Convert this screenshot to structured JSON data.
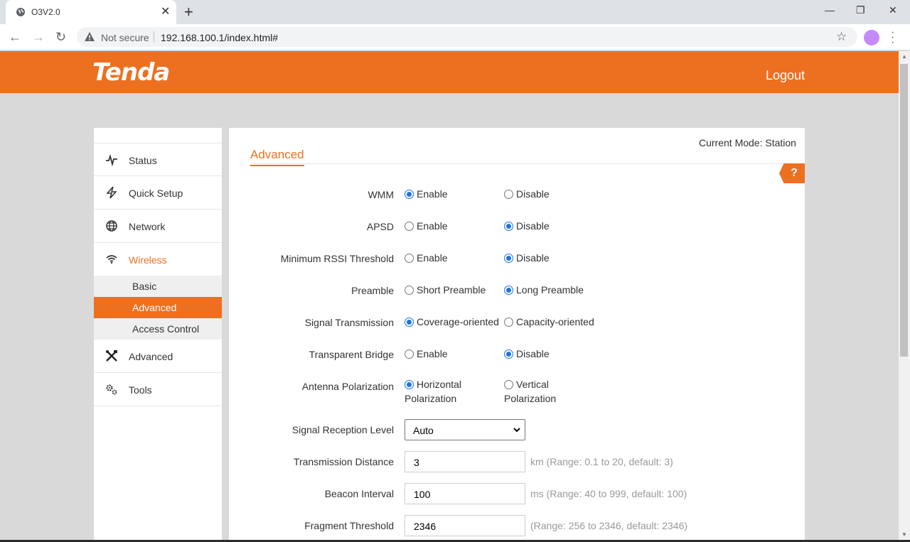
{
  "browser": {
    "tab_title": "O3V2.0",
    "tab_close": "✕",
    "new_tab": "+",
    "win_min": "—",
    "win_restore": "❐",
    "win_close": "✕",
    "back": "←",
    "forward": "→",
    "reload": "↻",
    "security_label": "Not secure",
    "url": "192.168.100.1/index.html#",
    "bookmark_star": "☆"
  },
  "header": {
    "logo": "Tenda",
    "logout": "Logout"
  },
  "sidebar": {
    "items": [
      {
        "label": "Status",
        "icon": "activity-icon"
      },
      {
        "label": "Quick Setup",
        "icon": "lightning-icon"
      },
      {
        "label": "Network",
        "icon": "globe-icon"
      },
      {
        "label": "Wireless",
        "icon": "wifi-icon",
        "active": true
      },
      {
        "label": "Advanced",
        "icon": "tools-icon"
      },
      {
        "label": "Tools",
        "icon": "gears-icon"
      }
    ],
    "subitems": [
      {
        "label": "Basic"
      },
      {
        "label": "Advanced",
        "active": true
      },
      {
        "label": "Access Control"
      }
    ]
  },
  "content": {
    "current_mode": "Current Mode: Station",
    "section_title": "Advanced",
    "help": "?",
    "radio_rows": [
      {
        "label": "WMM",
        "opt1": "Enable",
        "opt2": "Disable",
        "selected": 1
      },
      {
        "label": "APSD",
        "opt1": "Enable",
        "opt2": "Disable",
        "selected": 2
      },
      {
        "label": "Minimum RSSI Threshold",
        "opt1": "Enable",
        "opt2": "Disable",
        "selected": 2
      },
      {
        "label": "Preamble",
        "opt1": "Short Preamble",
        "opt2": "Long Preamble",
        "selected": 2
      },
      {
        "label": "Signal Transmission",
        "opt1": "Coverage-oriented",
        "opt2": "Capacity-oriented",
        "selected": 1
      },
      {
        "label": "Transparent Bridge",
        "opt1": "Enable",
        "opt2": "Disable",
        "selected": 2
      },
      {
        "label": "Antenna Polarization",
        "opt1_line1": "Horizontal",
        "opt1_line2": "Polarization",
        "opt2_line1": "Vertical",
        "opt2_line2": "Polarization",
        "selected": 1
      }
    ],
    "signal_reception": {
      "label": "Signal Reception Level",
      "value": "Auto"
    },
    "transmission_distance": {
      "label": "Transmission Distance",
      "value": "3",
      "hint": "km (Range: 0.1 to 20, default: 3)"
    },
    "beacon_interval": {
      "label": "Beacon Interval",
      "value": "100",
      "hint": "ms (Range: 40 to 999, default: 100)"
    },
    "fragment_threshold": {
      "label": "Fragment Threshold",
      "value": "2346",
      "hint": "(Range: 256 to 2346, default: 2346)"
    }
  },
  "colors": {
    "brand": "#ed7020",
    "radio_selected": "#1a73e8"
  }
}
